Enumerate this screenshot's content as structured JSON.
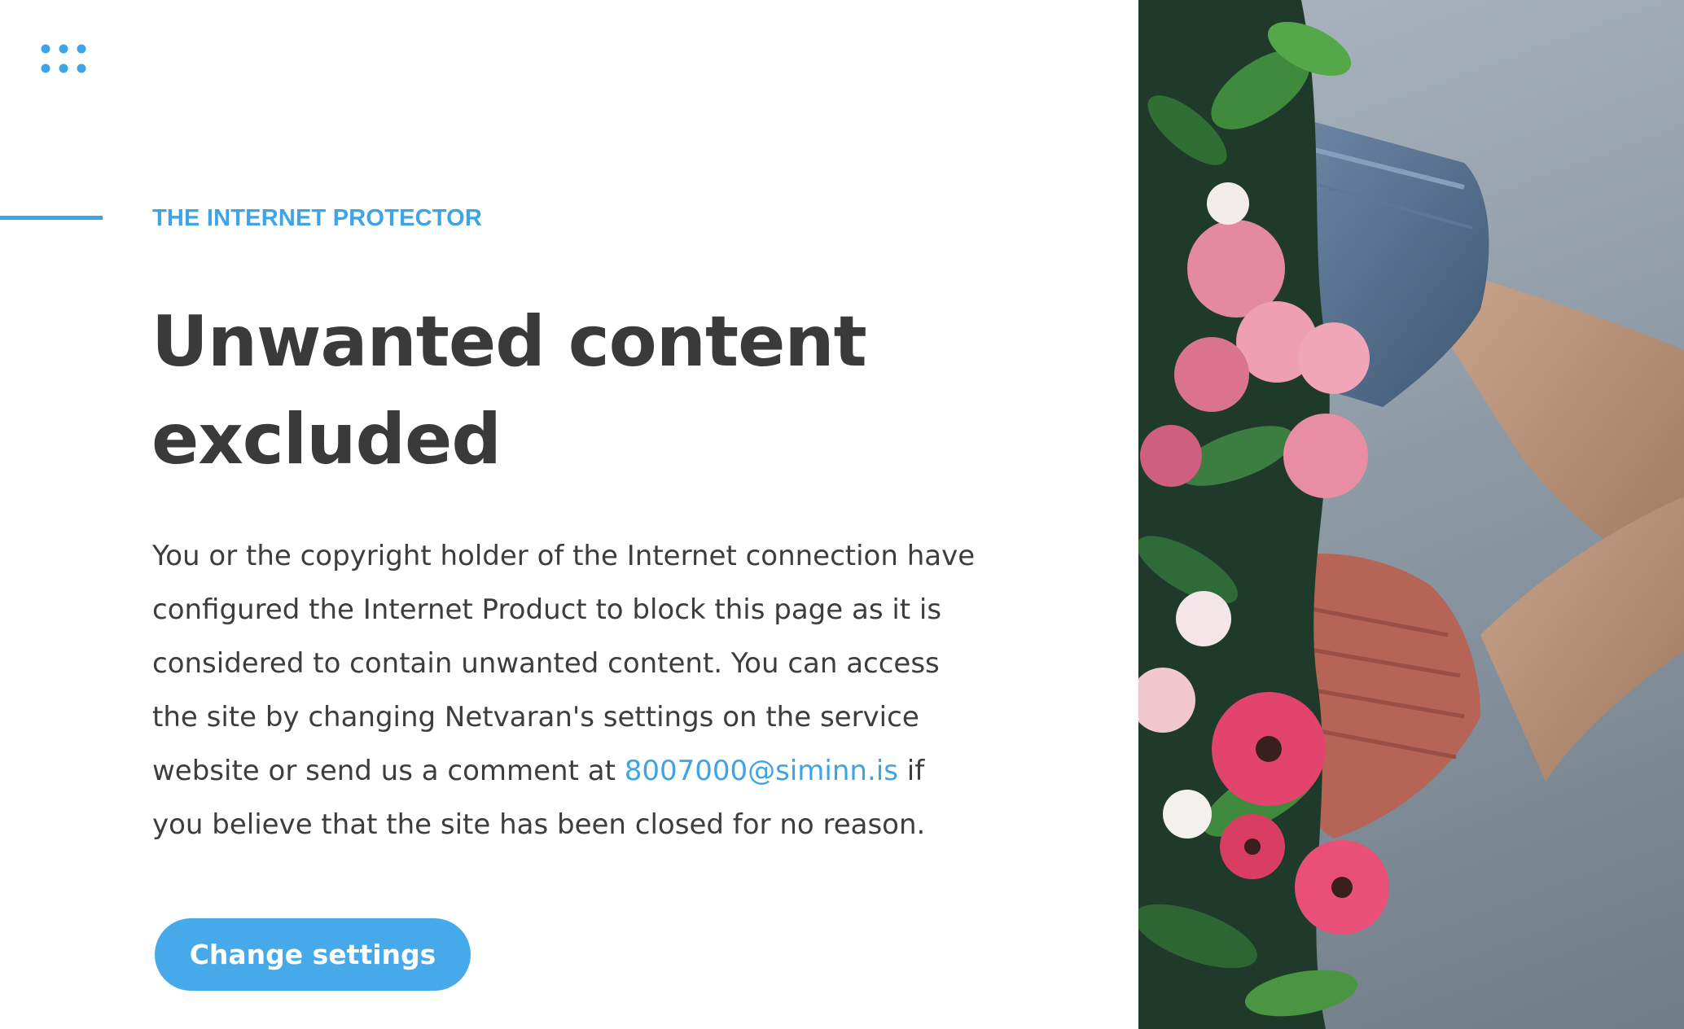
{
  "brand": {
    "logo_icon": "dot-grid-icon",
    "accent_color": "#3ea4e8"
  },
  "eyebrow": "THE INTERNET PROTECTOR",
  "headline": {
    "line1": "Unwanted content",
    "line2": "excluded"
  },
  "body": {
    "part1": "You or the copyright holder of the Internet connection have configured the Internet Product to block this page as it is considered to contain unwanted content. You can access the site by changing Netvaran's settings on the service website or send us a comment at ",
    "email": "8007000@siminn.is",
    "part2": " if you believe that the site has been closed for no reason."
  },
  "cta": {
    "label": "Change settings",
    "color": "#46a9ea"
  },
  "hero_image": {
    "icon": "flowers-photo"
  }
}
